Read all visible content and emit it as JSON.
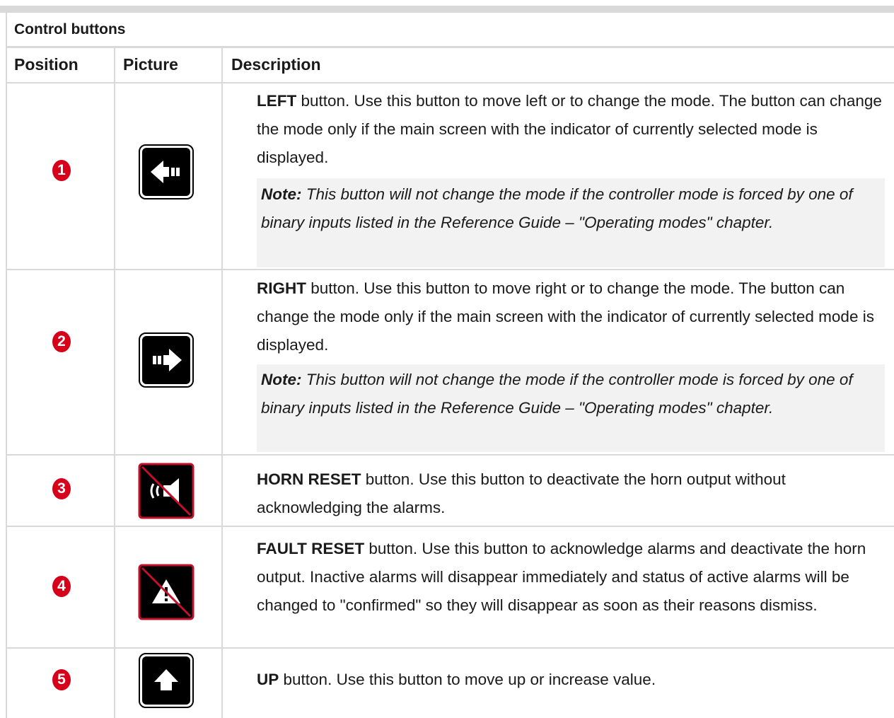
{
  "table": {
    "caption": "Control buttons",
    "headers": [
      "Position",
      "Picture",
      "Description"
    ],
    "rows": [
      {
        "position": "1",
        "icon": "left-arrow-button-icon",
        "name": "LEFT",
        "text": " button. Use this button to move left or to change the mode. The button can change the mode only if the main screen with the indicator of currently selected mode is displayed.",
        "note_label": "Note:",
        "note_text": " This button will not change the mode if the controller mode is forced by one of binary inputs listed in the Reference Guide – \"Operating modes\" chapter."
      },
      {
        "position": "2",
        "icon": "right-arrow-button-icon",
        "name": "RIGHT",
        "text": " button. Use this button to move right or to change the mode. The button can change the mode only if the main screen with the indicator of currently selected mode is displayed.",
        "note_label": "Note:",
        "note_text": " This button will not change the mode if the controller mode is forced by one of binary inputs listed in the Reference Guide – \"Operating modes\" chapter."
      },
      {
        "position": "3",
        "icon": "horn-reset-icon",
        "name": "HORN RESET",
        "text": " button. Use this button to deactivate the horn output without acknowledging the alarms."
      },
      {
        "position": "4",
        "icon": "fault-reset-icon",
        "name": "FAULT RESET",
        "text": " button. Use this button to acknowledge alarms and deactivate the horn output. Inactive alarms will disappear immediately and status of active alarms will be changed to \"confirmed\" so they will disappear as soon as their reasons dismiss."
      },
      {
        "position": "5",
        "icon": "up-arrow-button-icon",
        "name": "UP",
        "text": " button. Use this button to move up or increase value."
      }
    ]
  },
  "colors": {
    "badge": "#d7001a",
    "border": "#d9d9d9",
    "note_bg": "#f2f2f2",
    "icon_strike": "#c0102a"
  }
}
